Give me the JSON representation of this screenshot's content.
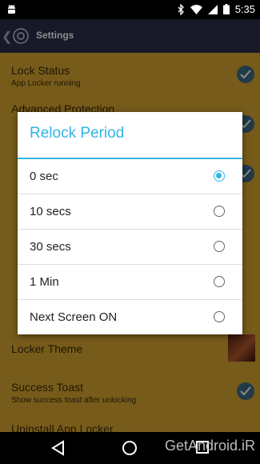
{
  "status_bar": {
    "time": "5:35"
  },
  "app_bar": {
    "title": "Settings"
  },
  "preferences": [
    {
      "title": "Lock Status",
      "summary": "App Locker running",
      "checked": true
    },
    {
      "title": "Advanced Protection",
      "summary": "",
      "checked": true
    },
    {
      "title": "",
      "summary": "",
      "checked": true
    },
    {
      "title": "",
      "summary": "",
      "checked": false
    },
    {
      "title": "",
      "summary": "",
      "checked": false
    },
    {
      "title": "",
      "summary": "",
      "checked": false
    },
    {
      "title": "Locker Theme",
      "summary": ""
    },
    {
      "title": "Success Toast",
      "summary": "Show success toast after unlocking",
      "checked": true
    },
    {
      "title": "Uninstall App Locker",
      "summary": ""
    }
  ],
  "dialog": {
    "title": "Relock Period",
    "options": [
      {
        "label": "0 sec",
        "selected": true
      },
      {
        "label": "10 secs",
        "selected": false
      },
      {
        "label": "30 secs",
        "selected": false
      },
      {
        "label": "1 Min",
        "selected": false
      },
      {
        "label": "Next Screen ON",
        "selected": false
      }
    ]
  },
  "watermark": "GetAndroid.iR",
  "colors": {
    "accent": "#33b5e5",
    "app_bar": "#2b2f4a",
    "settings_bg": "#d9a730"
  }
}
